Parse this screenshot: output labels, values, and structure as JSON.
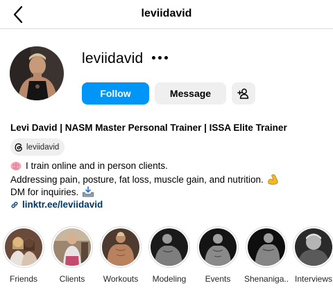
{
  "header": {
    "title": "leviidavid"
  },
  "profile": {
    "username": "leviidavid",
    "follow_label": "Follow",
    "message_label": "Message"
  },
  "bio": {
    "name_line": "Levi David | NASM Master Personal Trainer | ISSA Elite Trainer",
    "threads_handle": "leviidavid",
    "line1": "I train online and in person clients.",
    "line2": "Addressing pain, posture, fat loss, muscle gain, and nutrition.",
    "line3": "DM for inquiries.",
    "link": "linktr.ee/leviidavid"
  },
  "highlights": [
    {
      "label": "Friends"
    },
    {
      "label": "Clients"
    },
    {
      "label": "Workouts"
    },
    {
      "label": "Modeling"
    },
    {
      "label": "Events"
    },
    {
      "label": "Shenaniga..."
    },
    {
      "label": "Interviews"
    }
  ],
  "colors": {
    "follow": "#0095f6",
    "link": "#00376b",
    "button_bg": "#efefef",
    "divider": "#dbdbdb"
  },
  "icons": [
    "chevron-left-icon",
    "more-icon",
    "add-person-icon",
    "threads-icon",
    "brain-icon",
    "flexed-biceps-icon",
    "inbox-tray-icon",
    "link-icon"
  ]
}
